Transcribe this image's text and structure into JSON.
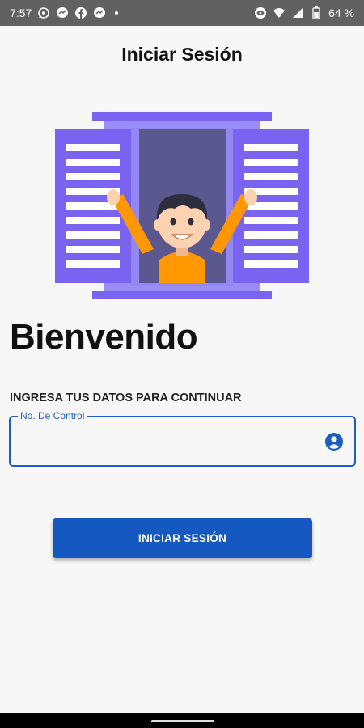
{
  "status_bar": {
    "time": "7:57",
    "battery": "64 %",
    "notification_icons": [
      "whatsapp-icon",
      "messenger-icon",
      "facebook-icon",
      "messenger-icon"
    ],
    "system_icons": [
      "eye-icon",
      "wifi-icon",
      "signal-icon",
      "battery-icon"
    ]
  },
  "header": {
    "title": "Iniciar Sesión"
  },
  "illustration": {
    "description_icon": "person-in-window-illustration",
    "colors": {
      "shutter": "#7a63f0",
      "frame": "#8f80f5",
      "glass": "#5a588f",
      "shirt": "#ff9800",
      "skin": "#fcd2b0",
      "hair": "#2d2d3f"
    }
  },
  "main": {
    "welcome": "Bienvenido",
    "subtitle": "INGRESA TUS DATOS PARA CONTINUAR",
    "control_field": {
      "label": "No. De Control",
      "value": "",
      "icon": "account-circle-icon"
    },
    "login_button": "INICIAR SESIÓN"
  },
  "colors": {
    "accent": "#1558c0",
    "background": "#f7f7f7",
    "status_bar": "#616161"
  }
}
